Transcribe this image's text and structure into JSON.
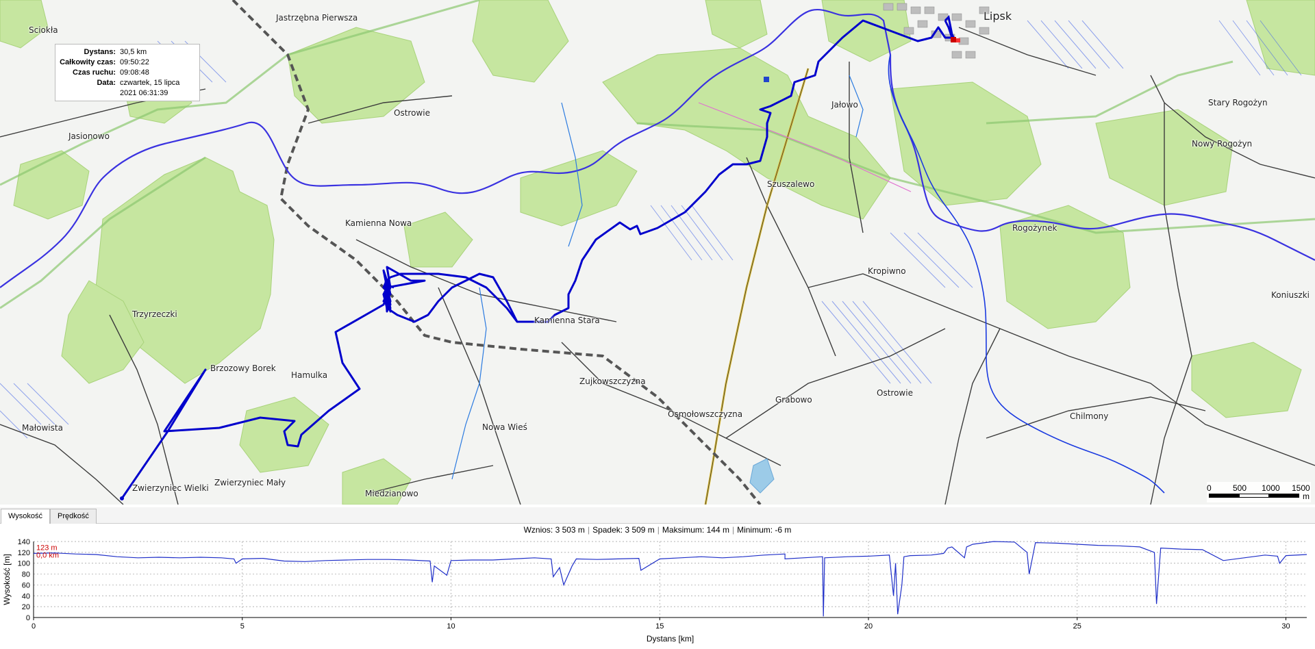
{
  "info_panel": {
    "distance_label": "Dystans:",
    "distance_value": "30,5 km",
    "total_time_label": "Całkowity czas:",
    "total_time_value": "09:50:22",
    "moving_time_label": "Czas ruchu:",
    "moving_time_value": "09:08:48",
    "date_label": "Data:",
    "date_value": "czwartek, 15 lipca 2021 06:31:39"
  },
  "places": [
    {
      "name": "Jastrzębna Pierwsza"
    },
    {
      "name": "Lipsk"
    },
    {
      "name": "Sciokła"
    },
    {
      "name": "Ostrowie"
    },
    {
      "name": "Jałowo"
    },
    {
      "name": "Stary Rogożyn"
    },
    {
      "name": "Nowy Rogożyn"
    },
    {
      "name": "Jasionowo"
    },
    {
      "name": "Szuszalewo"
    },
    {
      "name": "Kamienna Nowa"
    },
    {
      "name": "Rogożynek"
    },
    {
      "name": "Kropiwno"
    },
    {
      "name": "Koniuszki"
    },
    {
      "name": "Trzyrzeczki"
    },
    {
      "name": "Kamienna Stara"
    },
    {
      "name": "Brzozowy Borek"
    },
    {
      "name": "Hamulka"
    },
    {
      "name": "Zujkowszczyzna"
    },
    {
      "name": "Grabowo"
    },
    {
      "name": "Ostrowie"
    },
    {
      "name": "Osmołowszczyzna"
    },
    {
      "name": "Chilmony"
    },
    {
      "name": "Małowista"
    },
    {
      "name": "Nowa Wieś"
    },
    {
      "name": "Zwierzyniec Wielki"
    },
    {
      "name": "Zwierzyniec Mały"
    },
    {
      "name": "Miedzianowo"
    }
  ],
  "scale": {
    "l0": "0",
    "l1": "500",
    "l2": "1000",
    "l3": "1500",
    "unit": "m"
  },
  "tabs": {
    "elevation": "Wysokość",
    "speed": "Prędkość",
    "active": "elevation"
  },
  "stats": {
    "ascent": "Wznios: 3 503 m",
    "descent": "Spadek: 3 509 m",
    "max": "Maksimum: 144 m",
    "min": "Minimum: -6 m"
  },
  "colors": {
    "track": "#0000cc",
    "river": "#2a2ae0",
    "forest": "#c6e6a0",
    "marker": "#cc0000",
    "profile": "#1f2fc8"
  },
  "chart_data": {
    "type": "line",
    "xlabel": "Dystans [km]",
    "ylabel": "Wysokość [m]",
    "xlim": [
      0,
      30.5
    ],
    "ylim": [
      0,
      140
    ],
    "xticks": [
      "0",
      "5",
      "10",
      "15",
      "20",
      "25",
      "30"
    ],
    "yticks": [
      "0",
      "20",
      "40",
      "60",
      "80",
      "100",
      "120",
      "140"
    ],
    "grid": true,
    "cursor_label_elev": "123 m",
    "cursor_label_dist": "0,0 km",
    "series": [
      {
        "x": [
          0,
          0.5,
          1,
          1.5,
          2,
          2.5,
          3,
          3.5,
          4,
          4.5,
          4.8,
          4.85,
          5,
          5.5,
          6,
          6.5,
          7,
          7.5,
          8,
          8.5,
          9,
          9.5,
          9.55,
          9.6,
          9.9,
          10,
          10.5,
          11,
          11.5,
          12,
          12.4,
          12.45,
          12.6,
          12.7,
          12.9,
          13,
          13.5,
          14,
          14.5,
          14.55,
          15,
          15.5,
          16,
          16.5,
          17,
          17.5,
          18,
          18,
          18.9,
          18.92,
          18.95,
          19.5,
          20,
          20.5,
          20.6,
          20.65,
          20.7,
          20.8,
          20.85,
          21,
          21.5,
          21.8,
          21.9,
          22,
          22.3,
          22.35,
          22.5,
          23,
          23.5,
          23.8,
          23.85,
          24,
          24.5,
          25,
          25.5,
          26,
          26.5,
          26.85,
          26.9,
          27,
          27.5,
          28,
          28.5,
          29,
          29.5,
          29.8,
          29.85,
          30,
          30.5
        ],
        "y": [
          118,
          119,
          117,
          116,
          112,
          110,
          111,
          110,
          111,
          110,
          108,
          100,
          108,
          109,
          104,
          103,
          105,
          106,
          107,
          107,
          106,
          104,
          65,
          95,
          78,
          105,
          106,
          106,
          108,
          110,
          108,
          75,
          92,
          60,
          95,
          108,
          107,
          108,
          109,
          87,
          108,
          110,
          112,
          110,
          112,
          115,
          117,
          108,
          112,
          2,
          110,
          112,
          113,
          115,
          40,
          100,
          6,
          60,
          112,
          114,
          115,
          118,
          128,
          130,
          110,
          130,
          135,
          140,
          139,
          120,
          80,
          138,
          137,
          135,
          133,
          132,
          130,
          120,
          25,
          128,
          126,
          125,
          105,
          110,
          115,
          113,
          100,
          114,
          116
        ]
      }
    ]
  }
}
